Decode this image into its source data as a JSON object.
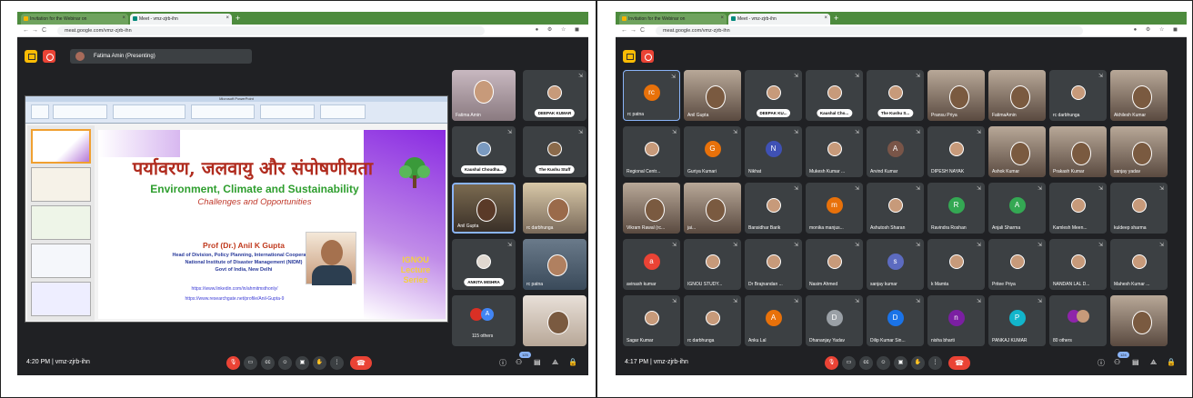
{
  "left": {
    "tabs": [
      {
        "label": "Invitation for the Webinar on"
      },
      {
        "label": "Meet - vmz-zjrb-ihn"
      }
    ],
    "url": "meat.google.com/vmz-zjrb-ihn",
    "presenter": "Fatima Amin (Presenting)",
    "slide": {
      "app_title": "Microsoft PowerPoint",
      "hindi_title": "पर्यावरण, जलवायु और संपोषणीयता",
      "english_title": "Environment, Climate and Sustainability",
      "subtitle": "Challenges and Opportunities",
      "speaker": "Prof (Dr.) Anil K Gupta",
      "line1": "Head of Division, Policy Planning, International Cooperation",
      "line2": "National Institute of Disaster Management (NIDM)",
      "line3": "Govt of India, New Delhi",
      "link1": "https://www.linkedin.com/in/ahmitmsthonly/",
      "link2": "https://www.researchgate.net/profile/Anil-Gupta-9",
      "badge": "IGNOU Lecture Series"
    },
    "tiles": [
      {
        "name": "Fatima Amin",
        "type": "cam"
      },
      {
        "name": "DEEPAK KUMAR",
        "type": "pill"
      },
      {
        "name": "Kaushal Choudha...",
        "type": "pill"
      },
      {
        "name": "The Kushu Stuff",
        "type": "pill"
      },
      {
        "name": "Anil Gupta",
        "type": "cam"
      },
      {
        "name": "rc darbhunga",
        "type": "cam"
      },
      {
        "name": "ANKITA MISHRA",
        "type": "pill"
      },
      {
        "name": "rc patna",
        "type": "cam"
      },
      {
        "name": "115 others",
        "type": "others",
        "initial": "A"
      },
      {
        "name": "",
        "type": "cam"
      }
    ],
    "time": "4:20 PM",
    "code": "vmz-zjrb-ihn",
    "participants": "125"
  },
  "right": {
    "tabs": [
      {
        "label": "Invitation for the Webinar on"
      },
      {
        "label": "Meet - vmz-zjrb-ihn"
      }
    ],
    "url": "meat.google.com/vmz-zjrb-ihn",
    "grid": [
      {
        "name": "rc patna",
        "initial": "rc",
        "color": "#e8710a"
      },
      {
        "name": "Anil Gupta",
        "cam": true
      },
      {
        "name": "DEEPAK KU...",
        "pill": true
      },
      {
        "name": "Kaushal Cho...",
        "pill": true
      },
      {
        "name": "The Kushu S...",
        "pill": true
      },
      {
        "name": "Pransu Priya",
        "cam": true
      },
      {
        "name": "FatimaAmin",
        "cam": true
      },
      {
        "name": "rc darbhunga",
        "photo": true
      },
      {
        "name": "Akhilesh Kumar",
        "cam": true
      },
      {
        "name": "Regional Centr...",
        "photo": true
      },
      {
        "name": "Guriya Kumari",
        "initial": "G",
        "color": "#e8710a"
      },
      {
        "name": "Nikhat",
        "initial": "N",
        "color": "#3f51b5"
      },
      {
        "name": "Mukesh Kumar ...",
        "photo": true
      },
      {
        "name": "Arvind Kumar",
        "initial": "A",
        "color": "#795548"
      },
      {
        "name": "DIPESH NAYAK",
        "photo": true
      },
      {
        "name": "Ashok Kumar",
        "cam": true
      },
      {
        "name": "Prakash Kumar",
        "cam": true
      },
      {
        "name": "sanjay yadav",
        "cam": true
      },
      {
        "name": "Vikram Rawal (rc...",
        "cam": true
      },
      {
        "name": "jai...",
        "cam": true
      },
      {
        "name": "Bansidhar Barik",
        "photo": true
      },
      {
        "name": "monika manjus...",
        "initial": "m",
        "color": "#e8710a"
      },
      {
        "name": "Ashutosh Sharan",
        "photo": true
      },
      {
        "name": "Ravindra Roshan",
        "initial": "R",
        "color": "#34a853"
      },
      {
        "name": "Anjali Sharma",
        "initial": "A",
        "color": "#34a853"
      },
      {
        "name": "Kamlesh Meen...",
        "photo": true
      },
      {
        "name": "kuldeep sharma",
        "photo": true
      },
      {
        "name": "avinash kumar",
        "initial": "a",
        "color": "#ea4335"
      },
      {
        "name": "IGNOU STUDY...",
        "photo": true
      },
      {
        "name": "Dr Brajnandan ...",
        "photo": true
      },
      {
        "name": "Nasim Ahmed",
        "photo": true
      },
      {
        "name": "sanjay kumar",
        "initial": "s",
        "color": "#5c6bc0"
      },
      {
        "name": "k Mamta",
        "photo": true
      },
      {
        "name": "Pritee Priya",
        "photo": true
      },
      {
        "name": "NANDAN LAL D...",
        "photo": true
      },
      {
        "name": "Mahesh Kumar ...",
        "photo": true
      },
      {
        "name": "Sagar Kumar",
        "photo": true
      },
      {
        "name": "rc darbhunga",
        "photo": true
      },
      {
        "name": "Anku Lal",
        "initial": "A",
        "color": "#e8710a"
      },
      {
        "name": "Dhananjay Yadav",
        "initial": "D",
        "color": "#9aa0a6"
      },
      {
        "name": "Dilip Kumar Sin...",
        "initial": "D",
        "color": "#1a73e8"
      },
      {
        "name": "nisha bharti",
        "initial": "n",
        "color": "#7b1fa2"
      },
      {
        "name": "PANKAJ KUMAR",
        "initial": "P",
        "color": "#12b5cb"
      },
      {
        "name": "80 others",
        "others": true
      },
      {
        "name": "",
        "cam": true
      }
    ],
    "time": "4:17 PM",
    "code": "vmz-zjrb-ihn",
    "participants": "124"
  }
}
